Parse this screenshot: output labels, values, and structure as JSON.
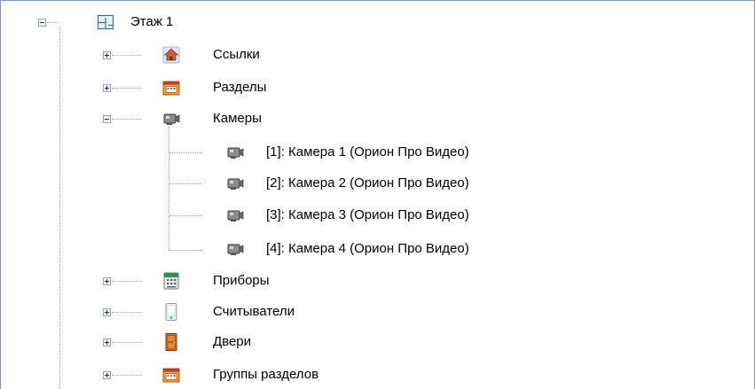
{
  "tree": {
    "root": {
      "label": "Этаж 1",
      "icon": "floor-plan-icon"
    },
    "groups": [
      {
        "label": "Ссылки",
        "icon": "home-link-icon",
        "expanded": false
      },
      {
        "label": "Разделы",
        "icon": "sections-icon",
        "expanded": false
      },
      {
        "label": "Камеры",
        "icon": "camera-icon",
        "expanded": true
      },
      {
        "label": "Приборы",
        "icon": "device-panel-icon",
        "expanded": false
      },
      {
        "label": "Считыватели",
        "icon": "card-reader-icon",
        "expanded": false
      },
      {
        "label": "Двери",
        "icon": "door-icon",
        "expanded": false
      },
      {
        "label": "Группы разделов",
        "icon": "section-groups-icon",
        "expanded": false
      }
    ],
    "cameras": [
      {
        "label": "[1]: Камера 1 (Орион Про Видео)",
        "icon": "camera-icon"
      },
      {
        "label": "[2]: Камера 2 (Орион Про Видео)",
        "icon": "camera-icon"
      },
      {
        "label": "[3]: Камера 3 (Орион Про Видео)",
        "icon": "camera-icon"
      },
      {
        "label": "[4]: Камера 4 (Орион Про Видео)",
        "icon": "camera-icon"
      }
    ]
  },
  "colors": {
    "frame_border": "#7a96c8",
    "connector": "#a0a0a0",
    "toggle_border": "#8fa4bd"
  }
}
